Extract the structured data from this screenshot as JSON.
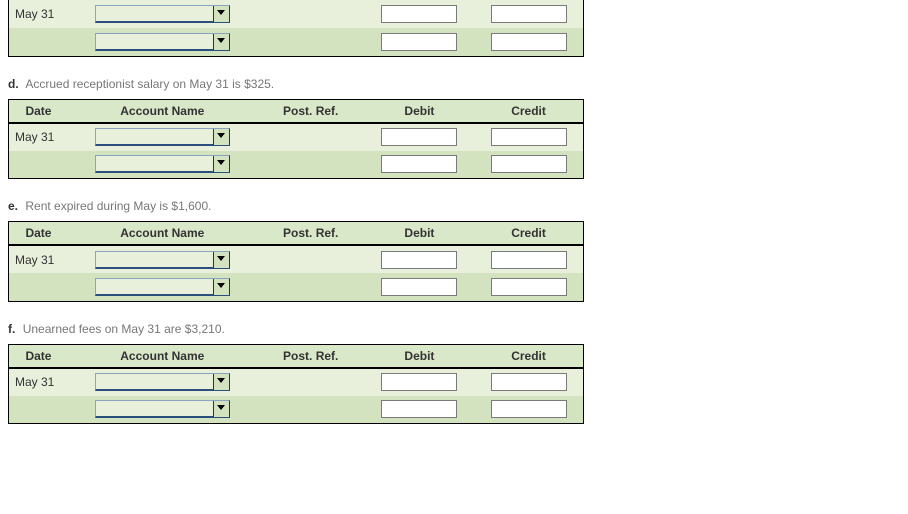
{
  "headers": {
    "date": "Date",
    "account": "Account Name",
    "postref": "Post. Ref.",
    "debit": "Debit",
    "credit": "Credit"
  },
  "date_label": "May 31",
  "sections": {
    "d": {
      "letter": "d.",
      "text": "Accrued receptionist salary on May 31 is $325."
    },
    "e": {
      "letter": "e.",
      "text": "Rent expired during May is $1,600."
    },
    "f": {
      "letter": "f.",
      "text": "Unearned fees on May 31 are $3,210."
    }
  }
}
